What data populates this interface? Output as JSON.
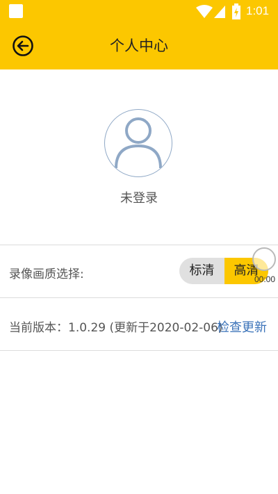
{
  "status_bar": {
    "time": "1:01"
  },
  "header": {
    "title": "个人中心"
  },
  "profile": {
    "login_status": "未登录"
  },
  "settings": {
    "quality_label": "录像画质选择:",
    "quality_options": [
      "标清",
      "高清"
    ],
    "quality_selected": "高清",
    "timer_text": "00:00"
  },
  "version": {
    "label": "当前版本：1.0.29 (更新于2020-02-06)",
    "check_update_label": "检查更新"
  },
  "colors": {
    "accent": "#fcc700",
    "link": "#3b73b9"
  }
}
